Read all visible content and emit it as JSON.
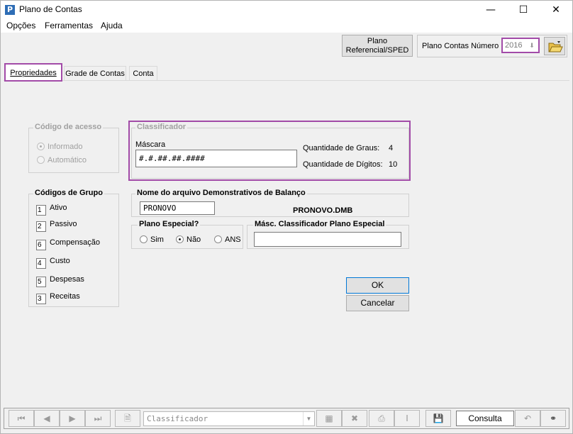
{
  "window": {
    "title": "Plano de Contas",
    "icon_letter": "P"
  },
  "menu": [
    "Opções",
    "Ferramentas",
    "Ajuda"
  ],
  "top": {
    "plano_referencial_line1": "Plano",
    "plano_referencial_line2": "Referencial/SPED",
    "plano_contas_numero_label": "Plano Contas Número",
    "plano_contas_numero_value": "2016"
  },
  "tabs": [
    "Propriedades",
    "Grade de Contas",
    "Conta"
  ],
  "codigo_acesso": {
    "title": "Código de acesso",
    "options": [
      "Informado",
      "Automático"
    ],
    "selected": "Informado"
  },
  "classificador": {
    "title": "Classificador",
    "mascara_label": "Máscara",
    "mascara_value": "#.#.##.##.####",
    "graus_label": "Quantidade de Graus:",
    "graus_value": "4",
    "digitos_label": "Quantidade de Dígitos:",
    "digitos_value": "10"
  },
  "codigos_grupo": {
    "title": "Códigos de Grupo",
    "items": [
      {
        "code": "1",
        "label": "Ativo"
      },
      {
        "code": "2",
        "label": "Passivo"
      },
      {
        "code": "6",
        "label": "Compensação"
      },
      {
        "code": "4",
        "label": "Custo"
      },
      {
        "code": "5",
        "label": "Despesas"
      },
      {
        "code": "3",
        "label": "Receitas"
      }
    ]
  },
  "demonstrativos": {
    "title": "Nome do arquivo Demonstrativos de Balanço",
    "value": "PRONOVO",
    "file": "PRONOVO.DMB"
  },
  "plano_especial": {
    "title": "Plano Especial?",
    "options": [
      "Sim",
      "Não",
      "ANS"
    ],
    "selected": "Não"
  },
  "masc_especial": {
    "title": "Másc. Classificador Plano Especial",
    "value": ""
  },
  "buttons": {
    "ok": "OK",
    "cancel": "Cancelar"
  },
  "bottom": {
    "combo_value": "Classificador",
    "status": "Consulta"
  },
  "colors": {
    "highlight": "#a24ba8",
    "background": "#f0f0f0"
  }
}
